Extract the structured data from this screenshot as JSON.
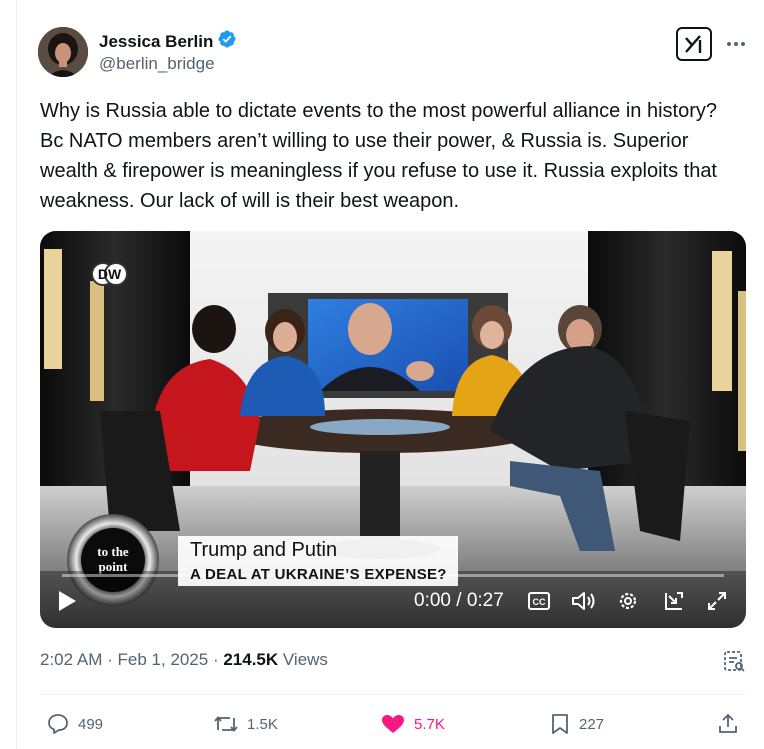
{
  "author": {
    "name": "Jessica Berlin",
    "handle": "@berlin_bridge",
    "verified": true
  },
  "tweet": {
    "text": "Why is Russia able to dictate events to the most powerful alliance in history? Bc NATO members aren’t willing to use their power, & Russia is. Superior wealth & firepower is meaningless if you refuse to use it. Russia exploits that weakness. Our lack of will is their best weapon."
  },
  "video": {
    "channel_logo": "DW",
    "show_badge_line1": "to the",
    "show_badge_line2": "point",
    "lower_third_title": "Trump and Putin",
    "lower_third_subtitle": "A DEAL AT UKRAINE’S EXPENSE?",
    "time": "0:00 / 0:27",
    "progress": 0
  },
  "meta": {
    "time": "2:02 AM",
    "dot1": " · ",
    "date": "Feb 1, 2025",
    "dot2": " · ",
    "views_count": "214.5K",
    "views_label": " Views"
  },
  "actions": {
    "replies": "499",
    "reposts": "1.5K",
    "likes": "5.7K",
    "bookmarks": "227"
  },
  "colors": {
    "accent_blue": "#1d9bf0",
    "like_pink": "#f91880",
    "secondary_text": "#536471"
  }
}
